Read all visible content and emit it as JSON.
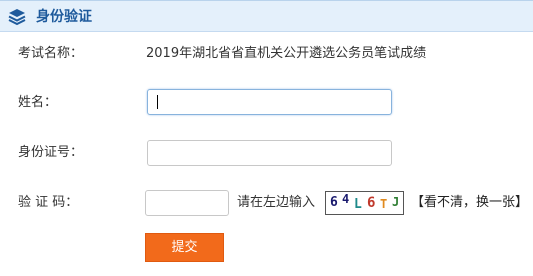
{
  "header": {
    "title": "身份验证",
    "icon": "layers-icon",
    "accent_color": "#1e5a9c"
  },
  "exam": {
    "label": "考试名称：",
    "value": "2019年湖北省省直机关公开遴选公务员笔试成绩"
  },
  "name_field": {
    "label": "姓名：",
    "value": "",
    "placeholder": ""
  },
  "id_field": {
    "label": "身份证号：",
    "value": "",
    "placeholder": ""
  },
  "captcha_field": {
    "label": "验 证 码：",
    "value": "",
    "placeholder": "",
    "hint": "请在左边输入",
    "captcha_chars": [
      {
        "char": "6",
        "color": "#1a1a6e"
      },
      {
        "char": "4",
        "color": "#1a1a6e"
      },
      {
        "char": "L",
        "color": "#1f8a8a"
      },
      {
        "char": "6",
        "color": "#c0392b"
      },
      {
        "char": "T",
        "color": "#e08a1e"
      },
      {
        "char": "J",
        "color": "#2e7d32"
      }
    ],
    "refresh_label": "【看不清，换一张】"
  },
  "submit": {
    "label": "提交",
    "color": "#f26a1b"
  }
}
